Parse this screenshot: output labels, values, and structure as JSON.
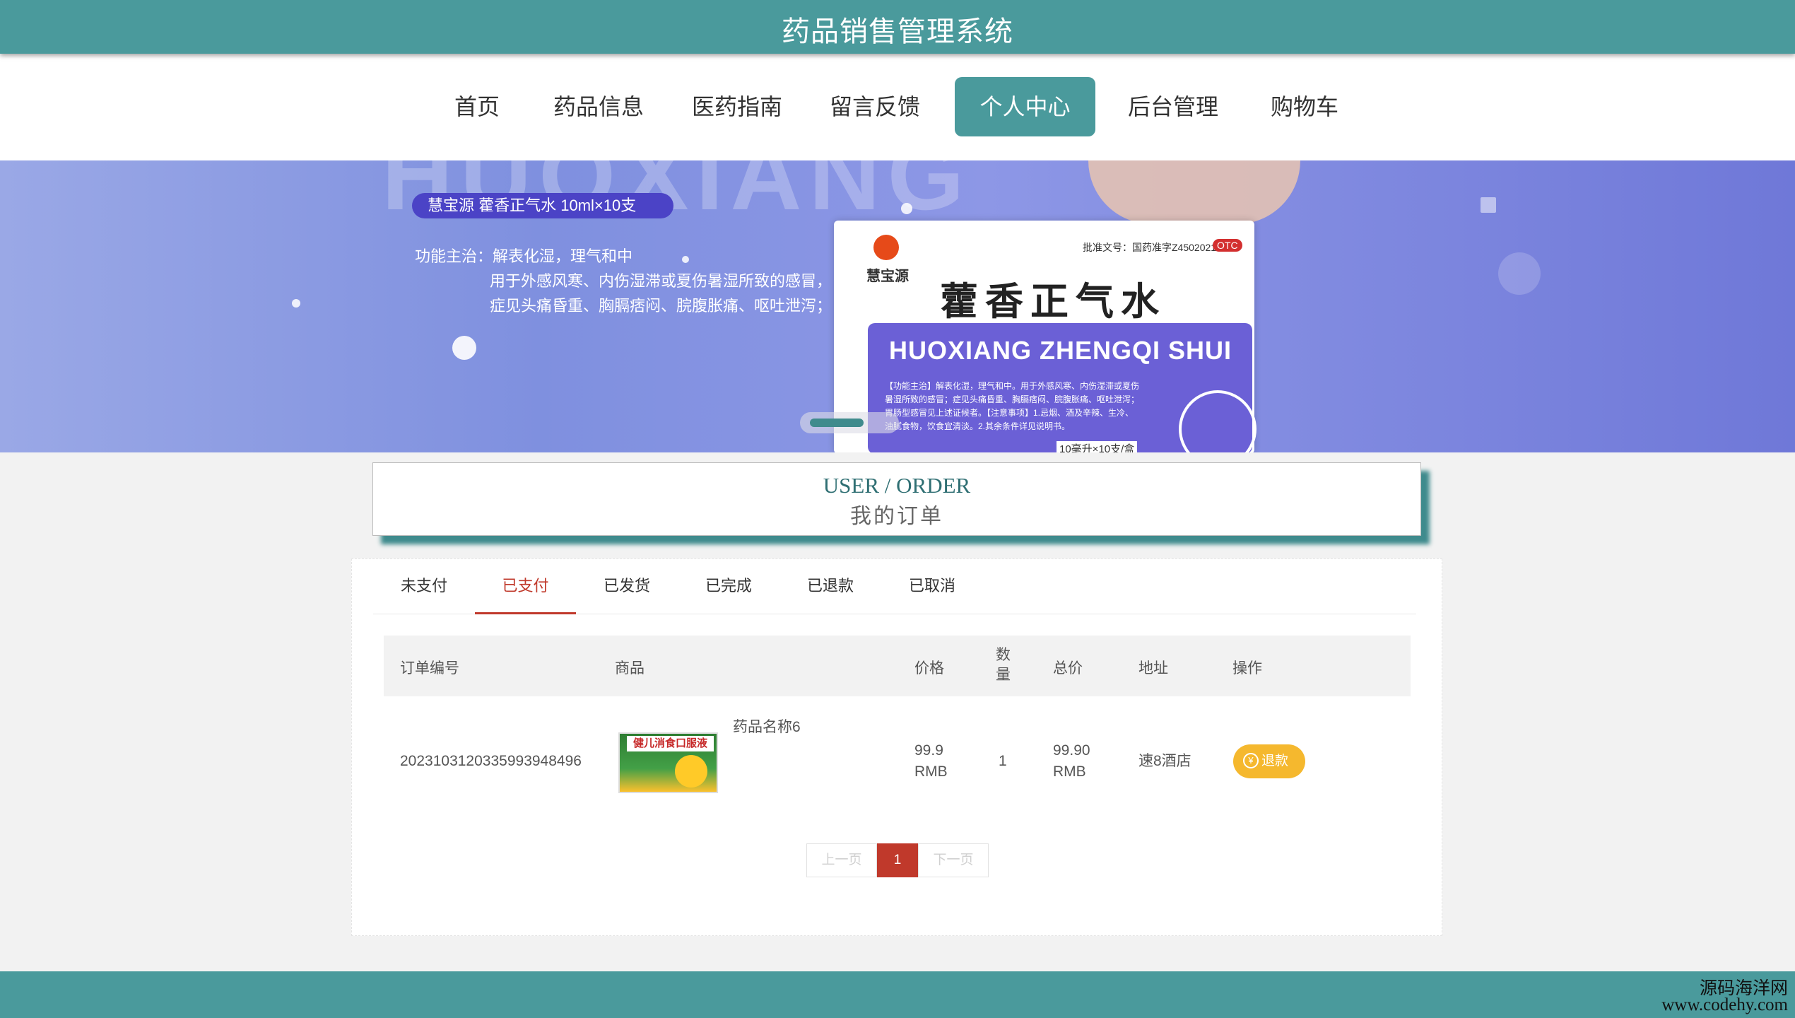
{
  "header": {
    "title": "药品销售管理系统"
  },
  "nav": {
    "items": [
      {
        "label": "首页"
      },
      {
        "label": "药品信息"
      },
      {
        "label": "医药指南"
      },
      {
        "label": "留言反馈"
      },
      {
        "label": "个人中心",
        "active": true
      },
      {
        "label": "后台管理"
      },
      {
        "label": "购物车"
      }
    ]
  },
  "banner": {
    "pill": "慧宝源    藿香正气水 10ml×10支",
    "function_label": "功能主治：解表化湿，理气和中",
    "function_line2": "用于外感风寒、内伤湿滞或夏伤暑湿所致的感冒，",
    "function_line3": "症见头痛昏重、胸膈痞闷、脘腹胀痛、呕吐泄泻；",
    "brand": "慧宝源",
    "approval": "批准文号：国药准字Z45020216",
    "otc": "OTC",
    "product_name": "藿香正气水",
    "product_pinyin": "HUOXIANG ZHENGQI SHUI",
    "package_text": "【功能主治】解表化湿，理气和中。用于外感风寒、内伤湿滞或夏伤暑湿所致的感冒；症见头痛昏重、胸膈痞闷、脘腹胀痛、呕吐泄泻；胃肠型感冒见上述证候者。【注意事项】1.忌烟、酒及辛辣、生冷、油腻食物，饮食宜清淡。2.其余条件详见说明书。",
    "size_label": "10毫升×10支/盒"
  },
  "section": {
    "title_en": "USER / ORDER",
    "title_cn": "我的订单"
  },
  "tabs": [
    {
      "label": "未支付"
    },
    {
      "label": "已支付",
      "active": true
    },
    {
      "label": "已发货"
    },
    {
      "label": "已完成"
    },
    {
      "label": "已退款"
    },
    {
      "label": "已取消"
    }
  ],
  "table": {
    "headers": [
      "订单编号",
      "商品",
      "价格",
      "数量",
      "总价",
      "地址",
      "操作"
    ],
    "rows": [
      {
        "order_no": "20231031203359939484 96",
        "order_no_full": "2023103120335993948496",
        "product_name": "药品名称6",
        "thumb_text": "健儿消食口服液",
        "price": "99.9 RMB",
        "price_num": "99.9",
        "price_unit": "RMB",
        "qty": "1",
        "total_num": "99.90",
        "total_unit": "RMB",
        "address": "速8酒店",
        "action": "退款"
      }
    ]
  },
  "pagination": {
    "prev": "上一页",
    "current": "1",
    "next": "下一页"
  },
  "watermark": {
    "line1": "源码海洋网",
    "line2": "www.codehy.com"
  },
  "colors": {
    "teal": "#4a9a9c",
    "red": "#c0392b",
    "yellow": "#f5b82e"
  }
}
